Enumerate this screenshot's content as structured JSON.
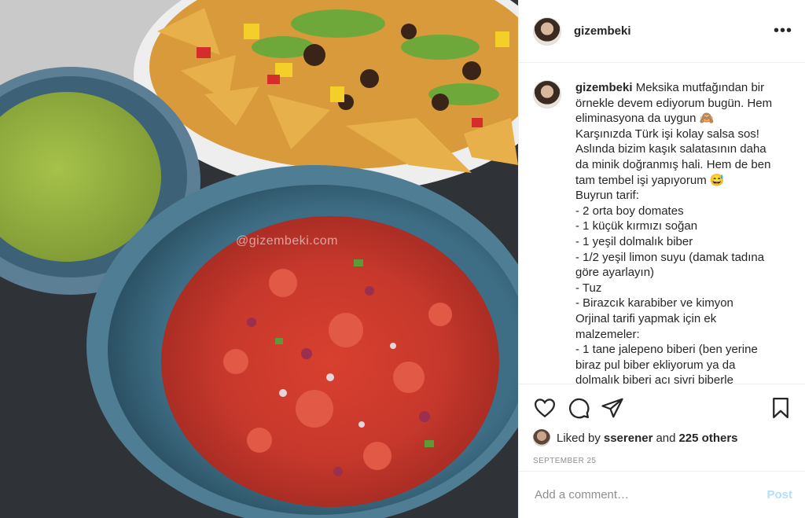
{
  "photo": {
    "watermark": "@gizembeki.com",
    "alt": "Salsa, guacamole and nachos in bowls"
  },
  "header": {
    "username": "gizembeki",
    "more_icon": "more-horizontal-icon"
  },
  "caption": {
    "username": "gizembeki",
    "text": "Meksika mutfağından bir\nörnekle devem ediyorum bugün. Hem\neliminasyona da uygun 🙈\nKarşınızda Türk işi kolay salsa sos!\nAslında bizim kaşık salatasının daha\nda minik doğranmış hali. Hem de ben\ntam tembel işi yapıyorum 😅\nBuyrun tarif:\n- 2 orta boy domates\n- 1 küçük kırmızı soğan\n- 1 yeşil dolmalık biber\n- 1/2 yeşil limon suyu (damak tadına\ngöre ayarlayın)\n- Tuz\n- Birazcık karabiber ve kimyon\nOrjinal tarifi yapmak için ek\nmalzemeler:\n- 1 tane jalepeno biberi (ben yerine\nbiraz pul biber ekliyorum ya da\ndolmalık biberi acı sivri biberle"
  },
  "actions": {
    "icons": [
      "heart-icon",
      "comment-icon",
      "share-icon",
      "bookmark-icon"
    ]
  },
  "likes": {
    "prefix": "Liked by",
    "user": "sserener",
    "connector": "and",
    "others": "225 others"
  },
  "date": "SEPTEMBER 25",
  "comment_box": {
    "placeholder": "Add a comment…",
    "post_label": "Post"
  },
  "colors": {
    "post_button": "#b2dffc",
    "text": "#262626",
    "muted": "#8e8e8e"
  }
}
